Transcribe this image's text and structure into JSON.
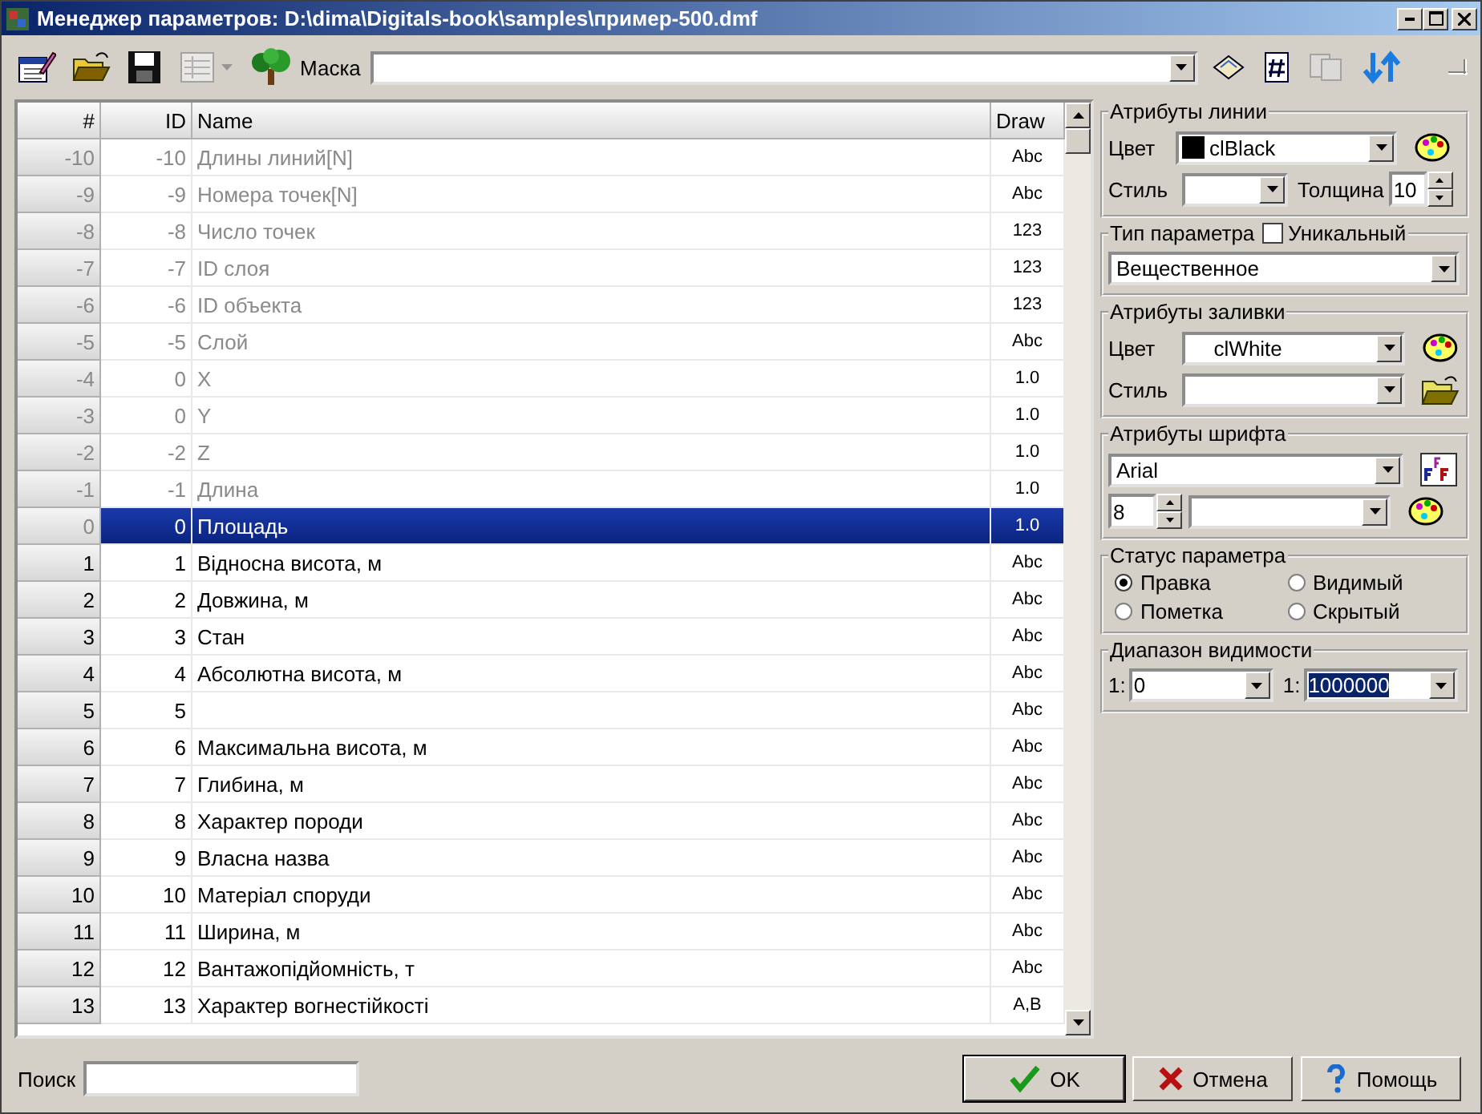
{
  "window": {
    "title": "Менеджер параметров: D:\\dima\\Digitals-book\\samples\\пример-500.dmf"
  },
  "toolbar": {
    "mask_label": "Маска"
  },
  "table": {
    "columns": [
      "#",
      "ID",
      "Name",
      "Draw"
    ],
    "rows": [
      {
        "num": "-10",
        "id": "-10",
        "name": "Длины линий[N]",
        "draw": "Abc",
        "dim": true,
        "selected": false
      },
      {
        "num": "-9",
        "id": "-9",
        "name": "Номера точек[N]",
        "draw": "Abc",
        "dim": true,
        "selected": false
      },
      {
        "num": "-8",
        "id": "-8",
        "name": "Число точек",
        "draw": "123",
        "dim": true,
        "selected": false
      },
      {
        "num": "-7",
        "id": "-7",
        "name": "ID слоя",
        "draw": "123",
        "dim": true,
        "selected": false
      },
      {
        "num": "-6",
        "id": "-6",
        "name": "ID объекта",
        "draw": "123",
        "dim": true,
        "selected": false
      },
      {
        "num": "-5",
        "id": "-5",
        "name": "Слой",
        "draw": "Abc",
        "dim": true,
        "selected": false
      },
      {
        "num": "-4",
        "id": "0",
        "name": "X",
        "draw": "1.0",
        "dim": true,
        "selected": false
      },
      {
        "num": "-3",
        "id": "0",
        "name": "Y",
        "draw": "1.0",
        "dim": true,
        "selected": false
      },
      {
        "num": "-2",
        "id": "-2",
        "name": "Z",
        "draw": "1.0",
        "dim": true,
        "selected": false
      },
      {
        "num": "-1",
        "id": "-1",
        "name": "Длина",
        "draw": "1.0",
        "dim": true,
        "selected": false
      },
      {
        "num": "0",
        "id": "0",
        "name": "Площадь",
        "draw": "1.0",
        "dim": true,
        "selected": true
      },
      {
        "num": "1",
        "id": "1",
        "name": "Відносна висота, м",
        "draw": "Abc",
        "dim": false,
        "selected": false
      },
      {
        "num": "2",
        "id": "2",
        "name": "Довжина, м",
        "draw": "Abc",
        "dim": false,
        "selected": false
      },
      {
        "num": "3",
        "id": "3",
        "name": "Стан",
        "draw": "Abc",
        "dim": false,
        "selected": false
      },
      {
        "num": "4",
        "id": "4",
        "name": "Абсолютна висота, м",
        "draw": "Abc",
        "dim": false,
        "selected": false
      },
      {
        "num": "5",
        "id": "5",
        "draw": "Abc",
        "dim": false,
        "selected": false
      },
      {
        "num": "6",
        "id": "6",
        "name": "Максимальна висота, м",
        "draw": "Abc",
        "dim": false,
        "selected": false
      },
      {
        "num": "7",
        "id": "7",
        "name": "Глибина, м",
        "draw": "Abc",
        "dim": false,
        "selected": false
      },
      {
        "num": "8",
        "id": "8",
        "name": "Характер породи",
        "draw": "Abc",
        "dim": false,
        "selected": false
      },
      {
        "num": "9",
        "id": "9",
        "name": "Власна назва",
        "draw": "Abc",
        "dim": false,
        "selected": false
      },
      {
        "num": "10",
        "id": "10",
        "name": "Матеріал споруди",
        "draw": "Abc",
        "dim": false,
        "selected": false
      },
      {
        "num": "11",
        "id": "11",
        "name": "Ширина, м",
        "draw": "Abc",
        "dim": false,
        "selected": false
      },
      {
        "num": "12",
        "id": "12",
        "name": "Вантажопідйомність, т",
        "draw": "Abc",
        "dim": false,
        "selected": false
      },
      {
        "num": "13",
        "id": "13",
        "name": "Характер вогнестійкості",
        "draw": "A,B",
        "dim": false,
        "selected": false
      }
    ]
  },
  "line_attributes": {
    "title": "Атрибуты линии",
    "color_label": "Цвет",
    "color_value": "clBlack",
    "color": "#000000",
    "style_label": "Стиль",
    "width_label": "Толщина",
    "width_value": "10"
  },
  "param_type": {
    "title": "Тип параметра",
    "unique_label": "Уникальный",
    "unique_checked": false,
    "value": "Вещественное"
  },
  "fill_attributes": {
    "title": "Атрибуты заливки",
    "color_label": "Цвет",
    "color_value": "clWhite",
    "style_label": "Стиль"
  },
  "font_attributes": {
    "title": "Атрибуты шрифта",
    "font": "Arial",
    "size": "8"
  },
  "status": {
    "title": "Статус параметра",
    "options": [
      {
        "label": "Правка",
        "selected": true
      },
      {
        "label": "Видимый",
        "selected": false
      },
      {
        "label": "Пометка",
        "selected": false
      },
      {
        "label": "Скрытый",
        "selected": false
      }
    ]
  },
  "visibility_range": {
    "title": "Диапазон видимости",
    "from_prefix": "1:",
    "from": "0",
    "to_prefix": "1:",
    "to": "1000000"
  },
  "search": {
    "label": "Поиск"
  },
  "buttons": [
    {
      "kind": "ok",
      "label": "OK"
    },
    {
      "kind": "cancel",
      "label": "Отмена"
    },
    {
      "kind": "help",
      "label": "Помощь"
    }
  ]
}
